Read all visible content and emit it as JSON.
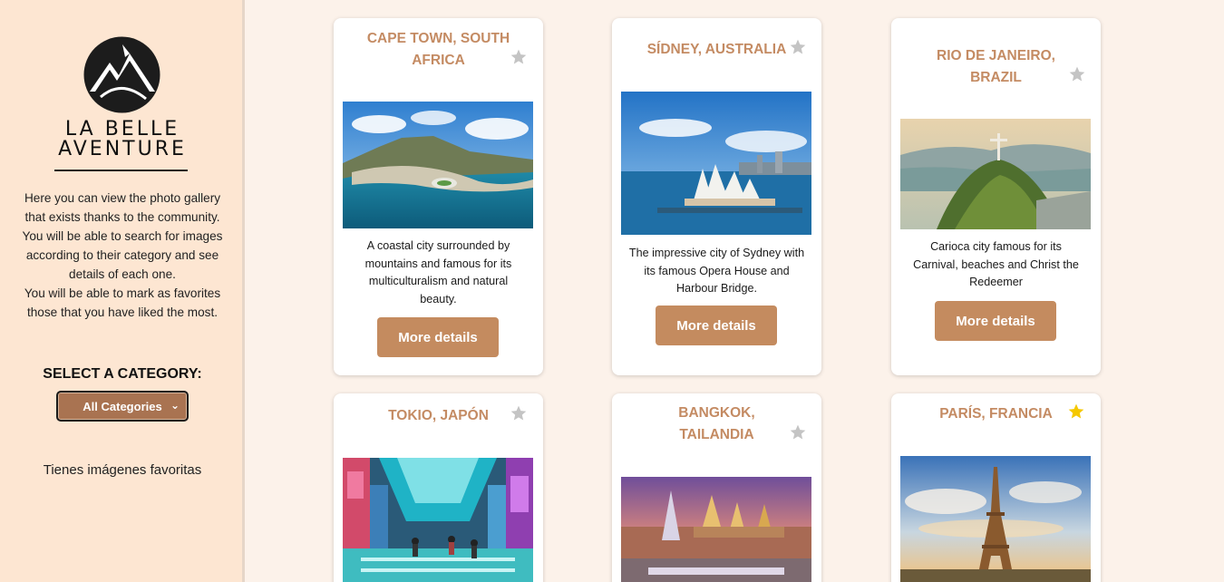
{
  "sidebar": {
    "brand_line1": "LA BELLE",
    "brand_line2": "AVENTURE",
    "intro_lines": [
      "Here you can view the photo gallery",
      "that exists thanks to the community.",
      "You will be able to search for images",
      "according to their category and see",
      "details of each one.",
      "You will be able to mark as favorites",
      "those that you have liked the most."
    ],
    "category_label": "SELECT A CATEGORY:",
    "category_selected": "All Categories",
    "favorites_text": "Tienes imágenes favoritas"
  },
  "cards": [
    {
      "title_lines": [
        "CAPE TOWN, SOUTH",
        "AFRICA"
      ],
      "description_lines": [
        "A coastal city surrounded by",
        "mountains and famous for its",
        "multiculturalism and natural",
        "beauty."
      ],
      "button": "More details",
      "favorite": false
    },
    {
      "title_lines": [
        "SÍDNEY, AUSTRALIA"
      ],
      "description_lines": [
        "The impressive city of Sydney with",
        "its famous Opera House and",
        "Harbour Bridge."
      ],
      "button": "More details",
      "favorite": false
    },
    {
      "title_lines": [
        "RIO DE JANEIRO,",
        "BRAZIL"
      ],
      "description_lines": [
        "Carioca city famous for its",
        "Carnival, beaches and Christ the",
        "Redeemer"
      ],
      "button": "More details",
      "favorite": false
    },
    {
      "title_lines": [
        "TOKIO, JAPÓN"
      ],
      "favorite": false
    },
    {
      "title_lines": [
        "BANGKOK,",
        "TAILANDIA"
      ],
      "favorite": false
    },
    {
      "title_lines": [
        "PARÍS, FRANCIA"
      ],
      "favorite": true
    }
  ],
  "colors": {
    "sidebar_bg": "#fde6d2",
    "page_bg": "#fcf2ea",
    "accent": "#c48b63",
    "star_off": "#c4c4c4",
    "star_on": "#f5c800"
  },
  "icons": {
    "logo": "mountain-logo-icon",
    "favorite": "star-icon",
    "dropdown": "chevron-down-icon"
  }
}
